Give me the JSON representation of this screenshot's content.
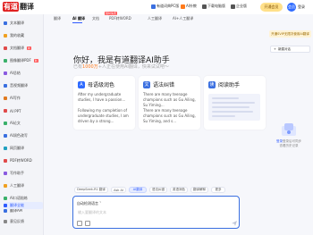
{
  "brand": {
    "badge": "有道",
    "name": "翻译"
  },
  "header": {
    "items": [
      {
        "label": "有道词典PC版"
      },
      {
        "label": "AI外教"
      },
      {
        "label": "下载电脑版"
      },
      {
        "label": "企业版"
      }
    ],
    "vip": "开通会员",
    "avatar": "会员",
    "login": "登录"
  },
  "sidebar": {
    "items": [
      {
        "label": "文本翻译",
        "color": "#3a6fe0"
      },
      {
        "label": "我的收藏",
        "color": "#f0a020"
      },
      {
        "label": "文档翻译",
        "color": "#e04a4a",
        "badge": "新"
      },
      {
        "label": "图像翻译PDF",
        "color": "#3ab06a",
        "badge": "新"
      },
      {
        "label": "AI总结",
        "color": "#8a5ae0"
      },
      {
        "label": "音视频翻译",
        "color": "#3a6fe0"
      },
      {
        "label": "AI写作",
        "color": "#e07a20"
      },
      {
        "label": "AI PPT",
        "color": "#e04a4a"
      },
      {
        "label": "AI论文",
        "color": "#3ab06a"
      },
      {
        "label": "AI润色改写",
        "color": "#3a6fe0"
      },
      {
        "label": "网页翻译",
        "color": "#20a0c0"
      },
      {
        "label": "PDF转WORD",
        "color": "#e04a4a"
      },
      {
        "label": "写作助手",
        "color": "#8a5ae0"
      },
      {
        "label": "人工翻译",
        "color": "#f0a020"
      },
      {
        "label": "AI口语陪练",
        "color": "#3ab06a"
      },
      {
        "label": "翻译API",
        "color": "#3a6fe0"
      },
      {
        "label": "翻译全能",
        "color": "#2f5bff"
      }
    ],
    "footer": "意见反馈"
  },
  "tabs": [
    {
      "label": "翻译"
    },
    {
      "label": "AI 翻译"
    },
    {
      "label": "文档"
    },
    {
      "label": "PDF转WORD"
    },
    {
      "label": "人工翻译"
    },
    {
      "label": "AI+人工翻译"
    }
  ],
  "tab_badge": "限时免费",
  "right_panel": {
    "vip_banner": "开通SVIP无限次使用AI翻译",
    "new_chat": "新建对话",
    "empty_line1": "登录后可同步",
    "empty_line2": "查看历史记录",
    "empty_link": "登录"
  },
  "hero": {
    "title": "你好，我是有道翻译AI助手",
    "subtitle_prefix": "已有",
    "subtitle_accent": "1000万",
    "subtitle_suffix": "+人正在使用AI翻译，快来试试吧～"
  },
  "cards": [
    {
      "title": "母语级润色",
      "icon": "A",
      "color": "#2f6bff",
      "text1": "After my undergraduate studies, I have a passion...",
      "text2": "Following my completion of undergraduate studies, I am driven by a strong..."
    },
    {
      "title": "语法纠错",
      "icon": "文",
      "color": "#3a6fe0",
      "text1": "There are many teenage champions such as Gu Ailing, Su Yiming...",
      "text2": "There are many teenage champions such as Gu Ailing, Su Yiming, and s..."
    },
    {
      "title": "阅读助手",
      "icon": "读",
      "color": "#3a6fe0"
    }
  ],
  "chips": [
    {
      "label": "DeepSeek-R1 翻译",
      "active": false
    },
    {
      "label": "Ask AI",
      "active": false
    },
    {
      "label": "AI翻译",
      "active": true
    },
    {
      "label": "语法纠错",
      "active": false
    },
    {
      "label": "英语润色",
      "active": false
    },
    {
      "label": "翻译解释",
      "active": false
    },
    {
      "label": "更多",
      "active": false
    }
  ],
  "input": {
    "mode": "自动检测语言",
    "placeholder": "输入要翻译的文本"
  }
}
